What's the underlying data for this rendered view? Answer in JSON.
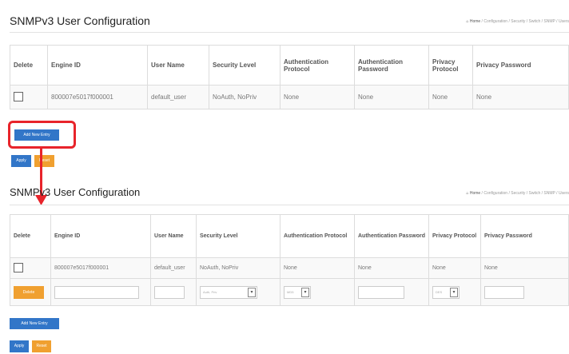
{
  "panel1": {
    "title": "SNMPv3 User Configuration",
    "breadcrumb": [
      "Home",
      "Configuration",
      "Security",
      "Switch",
      "SNMP",
      "Users"
    ],
    "headers": {
      "delete": "Delete",
      "engine_id": "Engine ID",
      "user_name": "User Name",
      "security_level": "Security Level",
      "auth_protocol": "Authentication Protocol",
      "auth_password": "Authentication Password",
      "privacy_protocol": "Privacy Protocol",
      "privacy_password": "Privacy Password"
    },
    "rows": [
      {
        "engine_id": "800007e5017f000001",
        "user_name": "default_user",
        "security_level": "NoAuth, NoPriv",
        "auth_protocol": "None",
        "auth_password": "None",
        "privacy_protocol": "None",
        "privacy_password": "None"
      }
    ],
    "add_button": "Add New Entry",
    "apply_button": "Apply",
    "reset_button": "Reset"
  },
  "panel2": {
    "title": "SNMPv3 User Configuration",
    "breadcrumb": [
      "Home",
      "Configuration",
      "Security",
      "Switch",
      "SNMP",
      "Users"
    ],
    "headers": {
      "delete": "Delete",
      "engine_id": "Engine ID",
      "user_name": "User Name",
      "security_level": "Security Level",
      "auth_protocol": "Authentication Protocol",
      "auth_password": "Authentication Password",
      "privacy_protocol": "Privacy Protocol",
      "privacy_password": "Privacy Password"
    },
    "rows": [
      {
        "engine_id": "800007e5017f000001",
        "user_name": "default_user",
        "security_level": "NoAuth, NoPriv",
        "auth_protocol": "None",
        "auth_password": "None",
        "privacy_protocol": "None",
        "privacy_password": "None"
      }
    ],
    "new_row": {
      "delete_button": "Delete",
      "security_level_selected": "Auth, Priv",
      "auth_protocol_selected": "MD5",
      "privacy_protocol_selected": "DES"
    },
    "add_button": "Add New Entry",
    "apply_button": "Apply",
    "reset_button": "Reset"
  },
  "colors": {
    "accent_blue": "#3276c8",
    "accent_orange": "#f0a030",
    "highlight_red": "#e8242b"
  }
}
